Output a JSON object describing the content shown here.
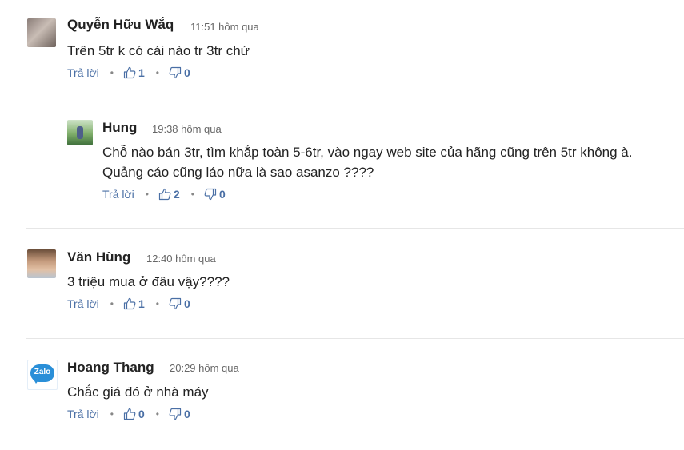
{
  "comments": [
    {
      "name": "Quyễn Hữu Wắq",
      "time": "11:51 hôm qua",
      "lines": [
        "Trên 5tr k có cái nào tr 3tr chứ"
      ],
      "reply": "Trả lời",
      "likes": "1",
      "dislikes": "0"
    },
    {
      "name": "Hung",
      "time": "19:38 hôm qua",
      "lines": [
        "Chỗ nào bán 3tr, tìm khắp toàn 5-6tr, vào ngay web site của hãng cũng trên 5tr không à.",
        "Quảng cáo cũng láo nữa là sao asanzo ????"
      ],
      "reply": "Trả lời",
      "likes": "2",
      "dislikes": "0"
    },
    {
      "name": "Văn Hùng",
      "time": "12:40 hôm qua",
      "lines": [
        "3 triệu mua ở đâu vậy????"
      ],
      "reply": "Trả lời",
      "likes": "1",
      "dislikes": "0"
    },
    {
      "name": "Hoang Thang",
      "time": "20:29 hôm qua",
      "lines": [
        "Chắc giá đó ở nhà máy"
      ],
      "reply": "Trả lời",
      "likes": "0",
      "dislikes": "0",
      "avatar_text": "Zalo"
    }
  ],
  "colors": {
    "link": "#4a6fa5",
    "divider": "#e6e6e6",
    "zalo": "#2a8fd8"
  }
}
